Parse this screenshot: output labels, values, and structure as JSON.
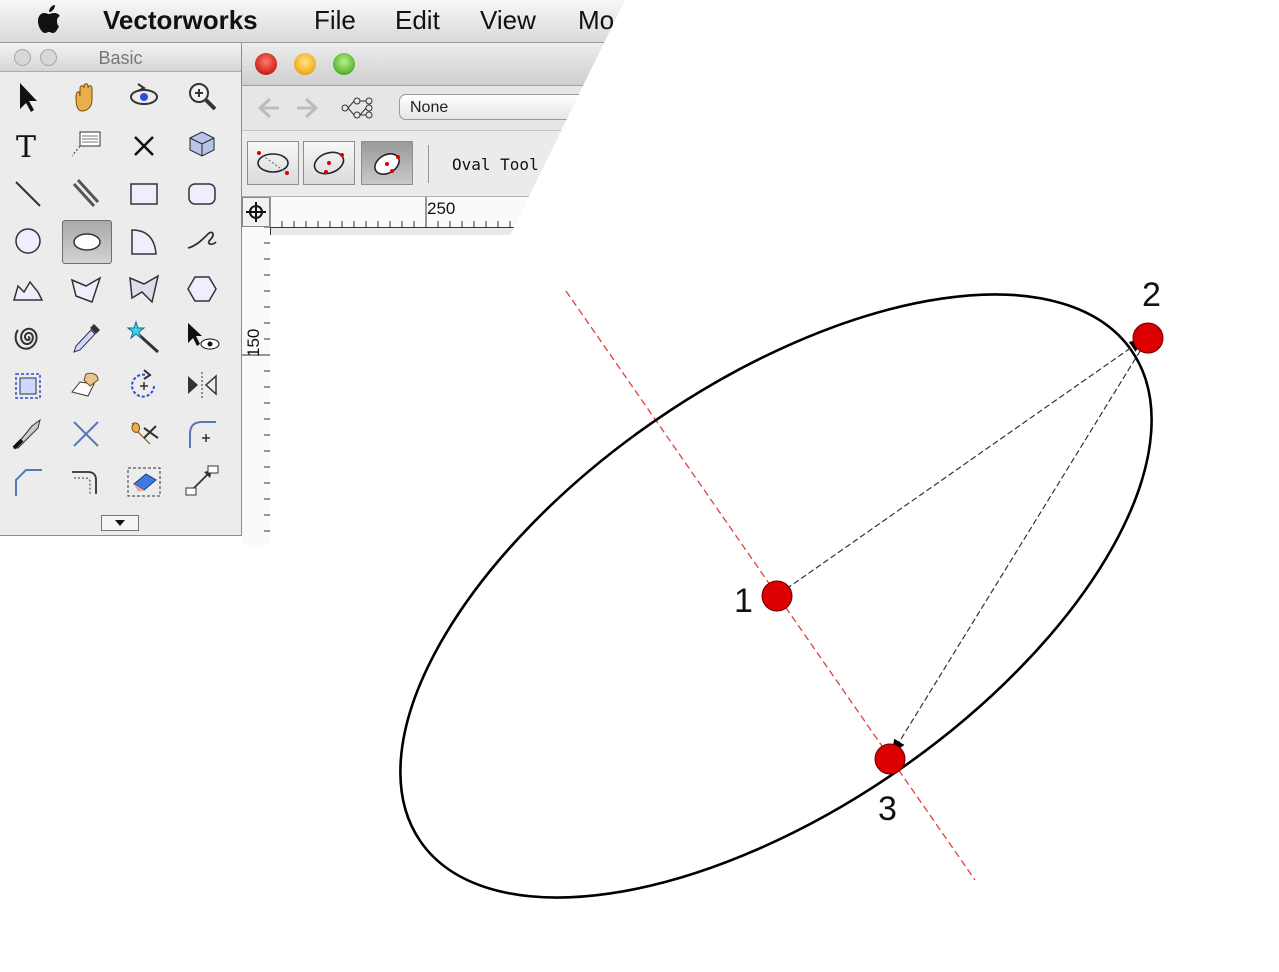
{
  "menubar": {
    "app_name": "Vectorworks",
    "items": [
      "File",
      "Edit",
      "View",
      "Mo"
    ]
  },
  "palette": {
    "title": "Basic",
    "tools": [
      "selection-arrow-icon",
      "pan-hand-icon",
      "flyover-icon",
      "zoom-icon",
      "text-icon",
      "callout-icon",
      "locus-x-icon",
      "3d-symbol-icon",
      "line-icon",
      "double-line-icon",
      "rectangle-icon",
      "rounded-rectangle-icon",
      "circle-icon",
      "oval-icon",
      "arc-icon",
      "freehand-icon",
      "polyline-icon",
      "polygon-icon",
      "double-polygon-icon",
      "regular-polygon-icon",
      "spiral-icon",
      "eyedropper-icon",
      "magic-wand-icon",
      "visibility-eye-icon",
      "resize-icon",
      "reshape-icon",
      "rotate-icon",
      "mirror-icon",
      "split-knife-icon",
      "trim-icon",
      "clip-scissors-icon",
      "fillet-icon",
      "chamfer-icon",
      "offset-icon",
      "eraser-icon",
      "connect-icon"
    ],
    "selected_index": 13
  },
  "document": {
    "class_select_value": "None",
    "tool_label": "Oval Tool :",
    "ruler_h_label": "250",
    "ruler_v_label": "150",
    "modes": [
      "oval-by-box-mode-icon",
      "oval-by-three-points-mode-icon",
      "oval-by-axes-mode-icon"
    ],
    "active_mode": 2
  },
  "diagram": {
    "points": [
      {
        "label": "1"
      },
      {
        "label": "2"
      },
      {
        "label": "3"
      }
    ],
    "colors": {
      "point": "#dd0000",
      "axis_line": "#e04040",
      "ellipse": "#000000",
      "arrow": "#000000"
    }
  }
}
